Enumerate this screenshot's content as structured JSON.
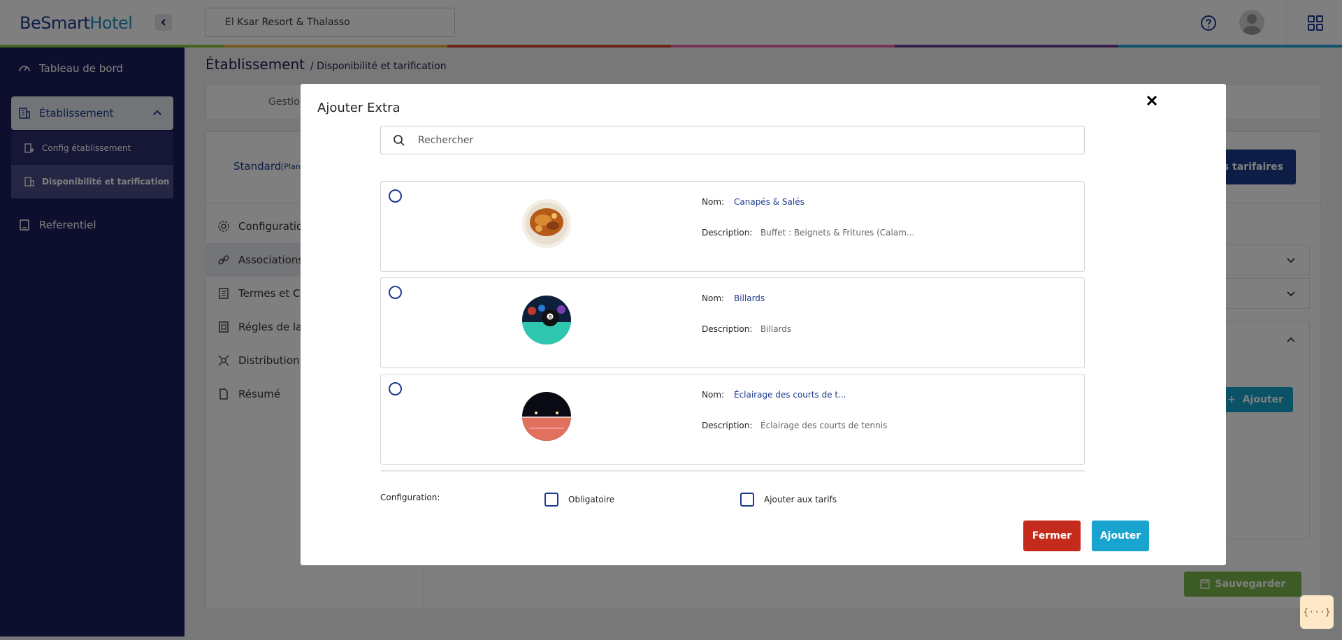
{
  "header": {
    "logo": {
      "part1": "Be",
      "part2": "Smart",
      "part3": "Hotel"
    },
    "hotel_selected": "El Ksar Resort & Thalasso",
    "color_bar": [
      "#8cc63f",
      "#f0b33f",
      "#d9472b",
      "#e86aa4",
      "#6a3a9c",
      "#1ea6d8"
    ]
  },
  "sidebar": {
    "items": [
      {
        "label": "Tableau de bord",
        "icon": "dashboard-icon"
      },
      {
        "label": "Établissement",
        "icon": "building-icon"
      },
      {
        "label": "Referentiel",
        "icon": "book-icon"
      }
    ],
    "submenu": [
      {
        "label": "Config établissement",
        "icon": "config-building-icon"
      },
      {
        "label": "Disponibilité et tarification",
        "icon": "availability-icon"
      }
    ]
  },
  "page": {
    "title": "Établissement",
    "subtitle": "/ Disponibilité et tarification",
    "tab_label": "Gestion",
    "plan_label": "Standard",
    "plan_tag": "[Plan",
    "plans_button": "lans tarifaires",
    "side_menu": [
      "Configuration",
      "Associations",
      "Termes et Co",
      "Régles de la",
      "Distribution",
      "Résumé"
    ],
    "add_button": "Ajouter",
    "save_button": "Sauvegarder"
  },
  "modal": {
    "title": "Ajouter Extra",
    "search_placeholder": "Rechercher",
    "name_label": "Nom:",
    "description_label": "Description:",
    "extras": [
      {
        "name": "Canapés & Salés",
        "description": "Buffet : Beignets & Fritures (Calam..."
      },
      {
        "name": "Billards",
        "description": "Billards"
      },
      {
        "name": "Éclairage des courts de t...",
        "description": "Éclairage des courts de tennis"
      }
    ],
    "config_label": "Configuration:",
    "option_mandatory": "Obligatoire",
    "option_add_to_rates": "Ajouter aux tarifs",
    "close_button": "Fermer",
    "add_button": "Ajouter"
  },
  "widget": {
    "label": "{···}"
  }
}
